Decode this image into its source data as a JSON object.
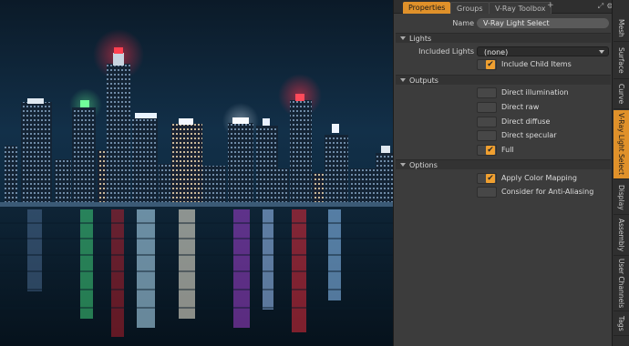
{
  "panel_tabs": {
    "properties": "Properties",
    "groups": "Groups",
    "vray_toolbox": "V-Ray Toolbox",
    "add": "+"
  },
  "name_row": {
    "label": "Name",
    "value": "V-Ray Light Select"
  },
  "sections": {
    "lights": "Lights",
    "outputs": "Outputs",
    "options": "Options"
  },
  "lights": {
    "included_label": "Included Lights",
    "included_value": "(none)",
    "include_child_items": {
      "label": "Include Child Items",
      "checked": true
    }
  },
  "outputs": [
    {
      "label": "Direct illumination",
      "checked": false
    },
    {
      "label": "Direct raw",
      "checked": false
    },
    {
      "label": "Direct diffuse",
      "checked": false
    },
    {
      "label": "Direct specular",
      "checked": false
    },
    {
      "label": "Full",
      "checked": true
    }
  ],
  "options": [
    {
      "label": "Apply Color Mapping",
      "checked": true
    },
    {
      "label": "Consider for Anti-Aliasing",
      "checked": false
    }
  ],
  "vertical_tabs": [
    {
      "label": "Mesh",
      "active": false
    },
    {
      "label": "Surface",
      "active": false
    },
    {
      "label": "Curve",
      "active": false
    },
    {
      "label": "V-Ray Light Select",
      "active": true
    },
    {
      "label": "Display",
      "active": false
    },
    {
      "label": "Assembly",
      "active": false
    },
    {
      "label": "User Channels",
      "active": false
    },
    {
      "label": "Tags",
      "active": false
    }
  ],
  "colors": {
    "accent": "#e0912a",
    "checkbox": "#f0a030",
    "panel_bg": "#3c3c3c"
  },
  "icons": {
    "checkmark": "✔",
    "expand": "expand-icon",
    "settings": "gear-icon"
  }
}
